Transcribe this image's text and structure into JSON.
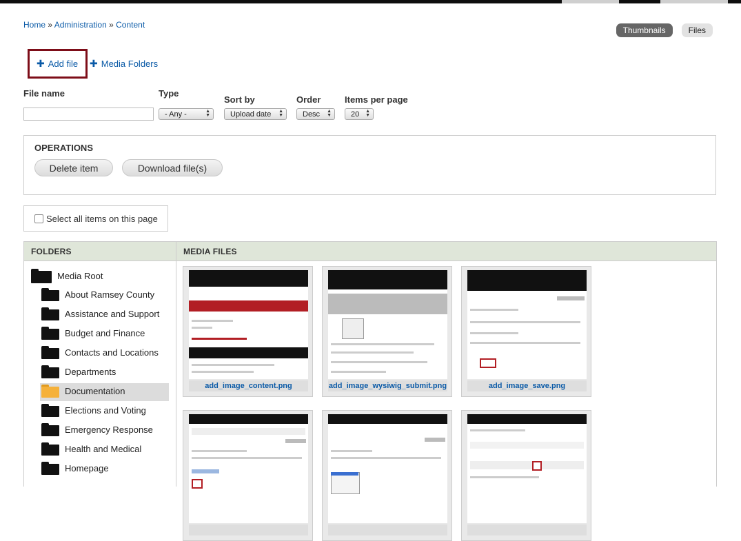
{
  "breadcrumb": {
    "home": "Home",
    "sep": "»",
    "admin": "Administration",
    "content": "Content"
  },
  "view_toggle": {
    "thumbnails": "Thumbnails",
    "files": "Files",
    "active": "Thumbnails"
  },
  "actions": {
    "add_file": "Add file",
    "media_folders": "Media Folders",
    "plus_glyph": "✚"
  },
  "filters": {
    "file_name_label": "File name",
    "file_name_value": "",
    "type_label": "Type",
    "type_value": "- Any -",
    "sort_label": "Sort by",
    "sort_value": "Upload date",
    "order_label": "Order",
    "order_value": "Desc",
    "items_label": "Items per page",
    "items_value": "20"
  },
  "operations": {
    "title": "OPERATIONS",
    "delete": "Delete item",
    "download": "Download file(s)"
  },
  "select_all": "Select all items on this page",
  "folders": {
    "header": "FOLDERS",
    "root": "Media Root",
    "items": [
      "About Ramsey County",
      "Assistance and Support",
      "Budget and Finance",
      "Contacts and Locations",
      "Departments",
      "Documentation",
      "Elections and Voting",
      "Emergency Response",
      "Health and Medical",
      "Homepage"
    ],
    "selected": "Documentation"
  },
  "media": {
    "header": "MEDIA FILES",
    "files": [
      "add_image_content.png",
      "add_image_wysiwig_submit.png",
      "add_image_save.png",
      "",
      "",
      ""
    ]
  },
  "colors": {
    "link": "#0a5aa7",
    "highlight_border": "#7d0d18",
    "panel_header": "#dfe6d9",
    "selected_folder": "#f5b13a"
  }
}
